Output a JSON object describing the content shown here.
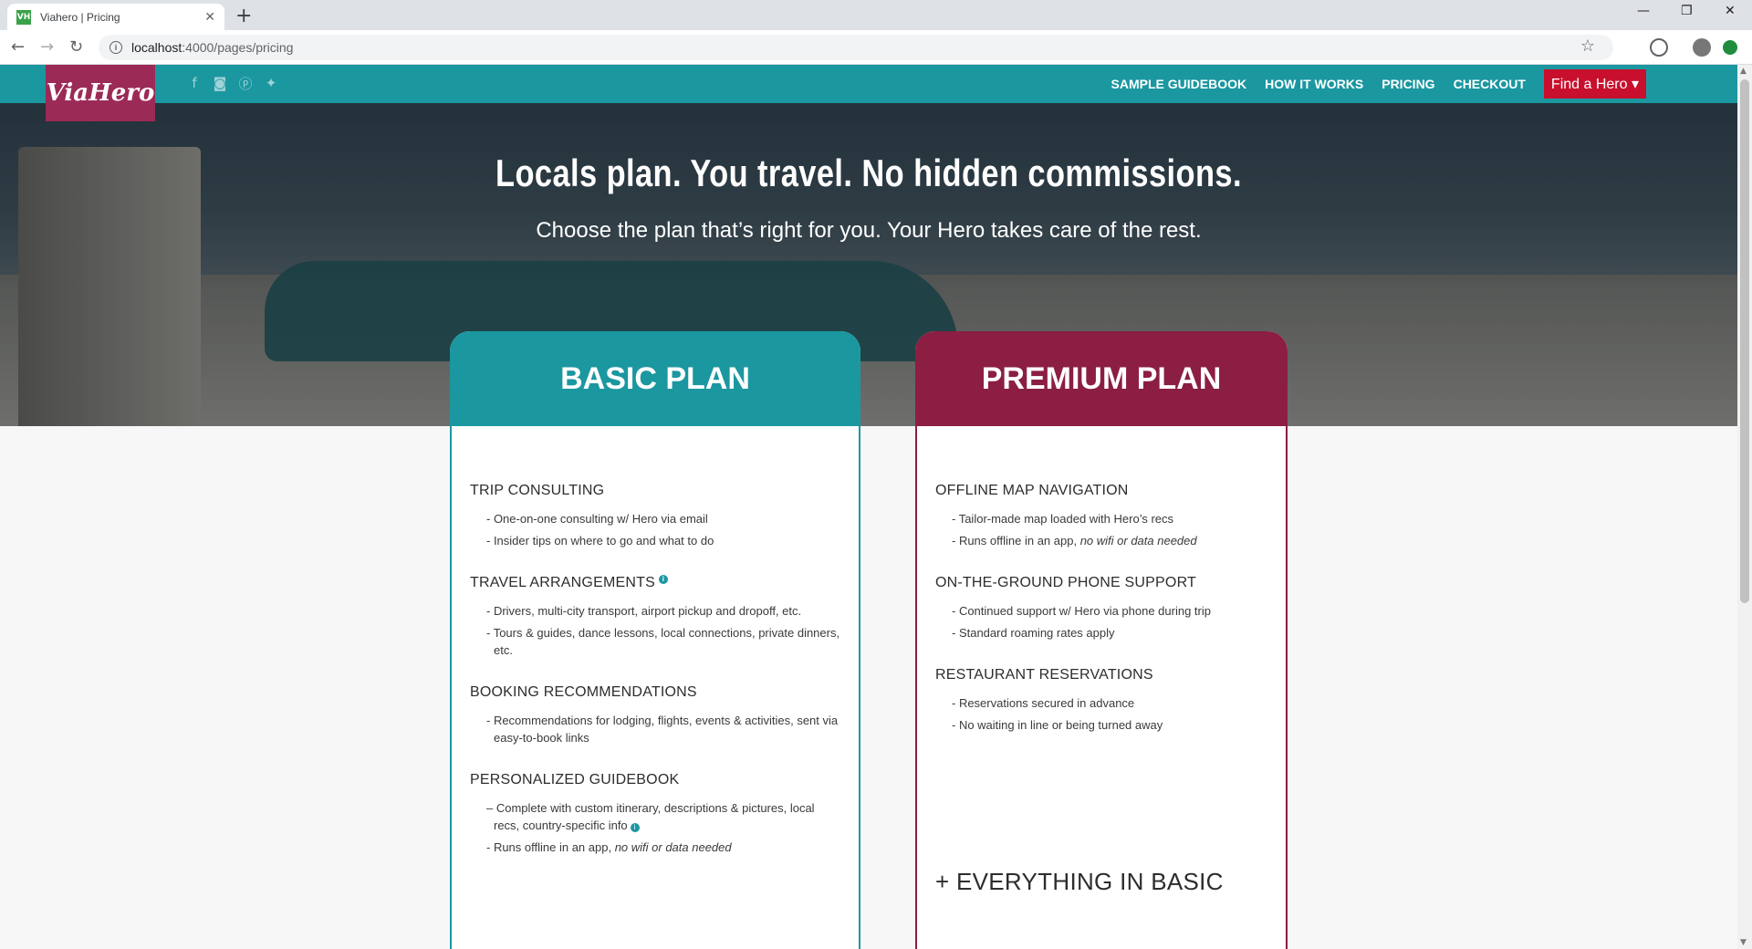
{
  "browser": {
    "tab_title": "Viahero | Pricing",
    "favicon_text": "VH",
    "url_host": "localhost",
    "url_path": ":4000/pages/pricing"
  },
  "nav": {
    "logo": "ViaHero",
    "links": [
      "SAMPLE GUIDEBOOK",
      "HOW IT WORKS",
      "PRICING",
      "CHECKOUT"
    ],
    "cta": "Find a Hero ▾"
  },
  "hero": {
    "headline": "Locals plan. You travel. No hidden commissions.",
    "subline": "Choose the plan that’s right for you. Your Hero takes care of the rest."
  },
  "basic": {
    "title": "BASIC PLAN",
    "sections": [
      {
        "title": "TRIP CONSULTING",
        "bullets": [
          "- One-on-one consulting w/ Hero via email",
          "- Insider tips on where to go and what to do"
        ]
      },
      {
        "title": "TRAVEL ARRANGEMENTS",
        "bullets": [
          "- Drivers, multi-city transport, airport pickup and dropoff, etc.",
          "- Tours & guides, dance lessons, local connections, private dinners, etc."
        ]
      },
      {
        "title": "BOOKING RECOMMENDATIONS",
        "bullets": [
          "- Recommendations for lodging, flights, events & activities, sent via easy-to-book links"
        ]
      },
      {
        "title": "PERSONALIZED GUIDEBOOK",
        "bullets": [
          "– Complete with custom itinerary, descriptions & pictures, local recs, country-specific info",
          "- Runs offline in an app, "
        ]
      }
    ],
    "offline_note": "no wifi or data needed"
  },
  "premium": {
    "title": "PREMIUM PLAN",
    "sections": [
      {
        "title": "OFFLINE MAP NAVIGATION",
        "bullets": [
          "- Tailor-made map loaded with Hero’s recs",
          "- Runs offline in an app, "
        ]
      },
      {
        "title": "ON-THE-GROUND PHONE SUPPORT",
        "bullets": [
          "- Continued support w/ Hero via phone during trip",
          "- Standard roaming rates apply"
        ]
      },
      {
        "title": "RESTAURANT RESERVATIONS",
        "bullets": [
          "- Reservations secured in advance",
          "- No waiting in line or being turned away"
        ]
      }
    ],
    "offline_note": "no wifi or data needed",
    "everything": "+ EVERYTHING IN BASIC"
  }
}
